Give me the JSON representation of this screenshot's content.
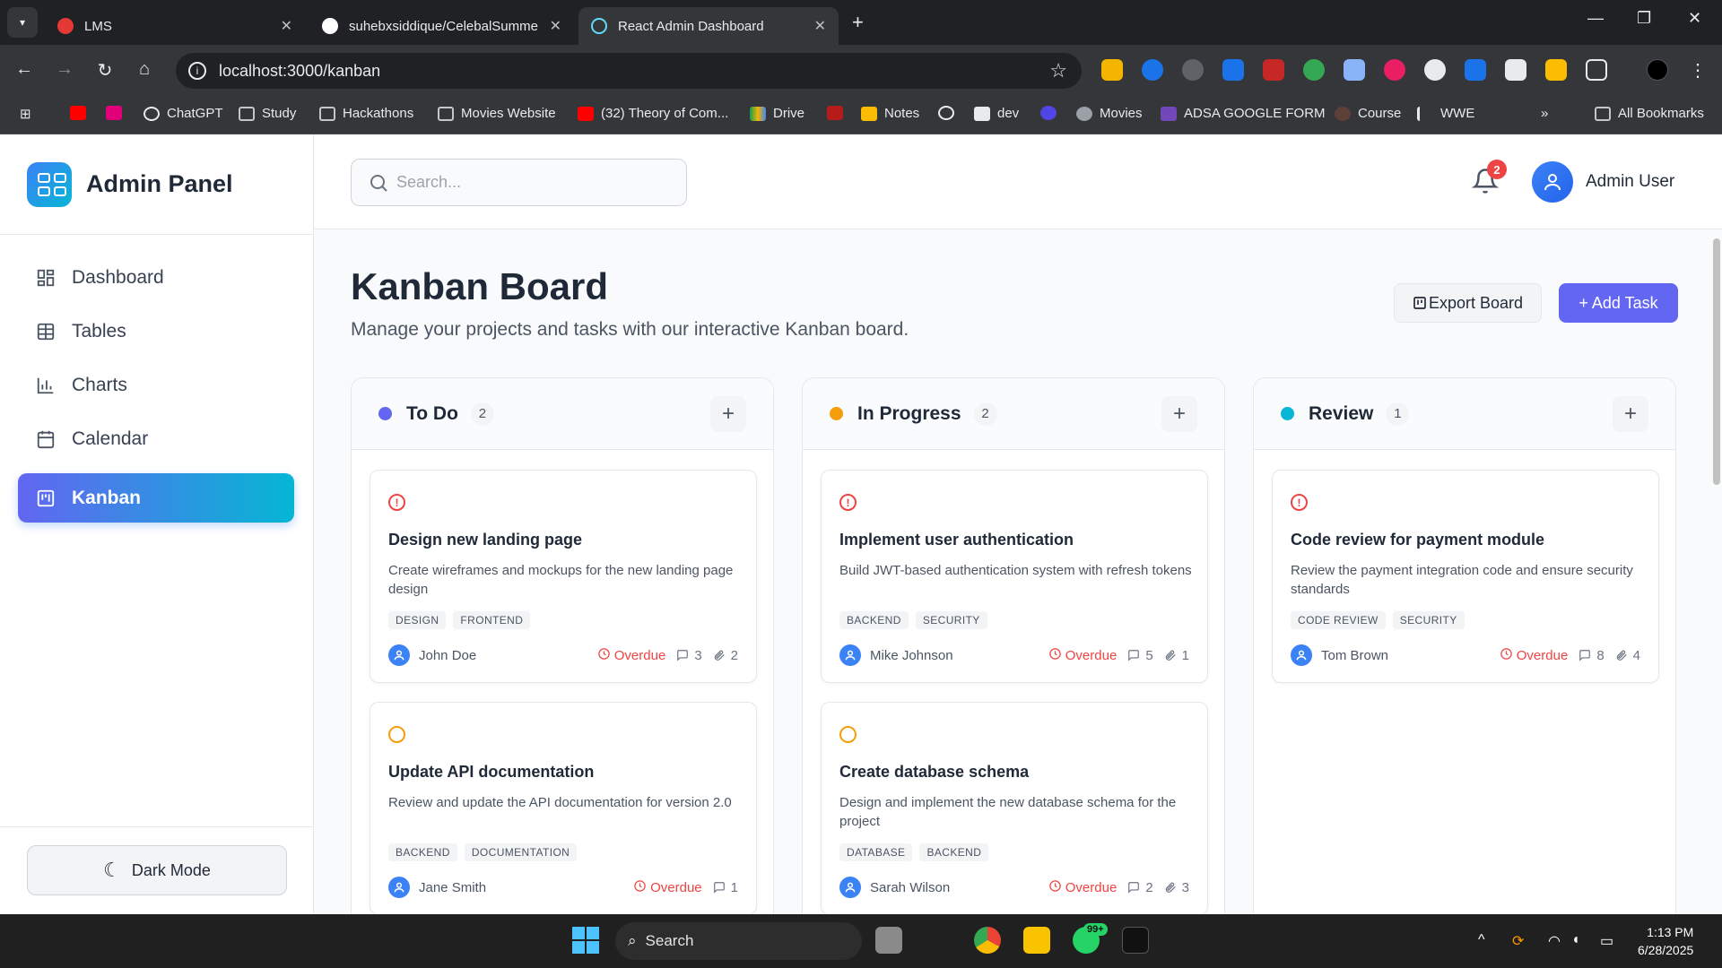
{
  "browser": {
    "tabs": [
      {
        "title": "LMS",
        "color": "#e53935",
        "active": false
      },
      {
        "title": "suhebxsiddique/CelebalSumme",
        "color": "#ffffff",
        "active": false
      },
      {
        "title": "React Admin Dashboard",
        "color": "#61dafb",
        "active": true
      }
    ],
    "url": "localhost:3000/kanban",
    "bookmarks": [
      {
        "label": "",
        "icon": "youtube-icon"
      },
      {
        "label": "",
        "icon": "m-icon"
      },
      {
        "label": "ChatGPT",
        "icon": "chatgpt-icon"
      },
      {
        "label": "Study",
        "icon": "folder-icon"
      },
      {
        "label": "Hackathons",
        "icon": "folder-icon"
      },
      {
        "label": "Movies Website",
        "icon": "folder-icon"
      },
      {
        "label": "(32) Theory of Com...",
        "icon": "youtube-icon"
      },
      {
        "label": "Drive",
        "icon": "drive-icon"
      },
      {
        "label": "",
        "icon": "cards-icon"
      },
      {
        "label": "Notes",
        "icon": "notes-icon"
      },
      {
        "label": "",
        "icon": "github-icon"
      },
      {
        "label": "dev",
        "icon": "search-icon"
      },
      {
        "label": "",
        "icon": "hex-icon"
      },
      {
        "label": "Movies",
        "icon": "globe-icon"
      },
      {
        "label": "ADSA GOOGLE FORM",
        "icon": "form-icon"
      },
      {
        "label": "Course",
        "icon": "course-icon"
      },
      {
        "label": "WWE",
        "icon": "k-icon"
      }
    ],
    "all_bookmarks": "All Bookmarks"
  },
  "sidebar": {
    "brand": "Admin Panel",
    "items": [
      {
        "label": "Dashboard",
        "icon": "dashboard-icon",
        "active": false
      },
      {
        "label": "Tables",
        "icon": "table-icon",
        "active": false
      },
      {
        "label": "Charts",
        "icon": "chart-icon",
        "active": false
      },
      {
        "label": "Calendar",
        "icon": "calendar-icon",
        "active": false
      },
      {
        "label": "Kanban",
        "icon": "kanban-icon",
        "active": true
      }
    ],
    "dark_mode": "Dark Mode"
  },
  "topbar": {
    "search_placeholder": "Search...",
    "notification_count": "2",
    "user_name": "Admin User"
  },
  "page": {
    "title": "Kanban Board",
    "subtitle": "Manage your projects and tasks with our interactive Kanban board.",
    "export_label": "Export Board",
    "add_label": "+ Add Task"
  },
  "columns": [
    {
      "title": "To Do",
      "count": "2",
      "color": "#6366f1",
      "cards": [
        {
          "priority": "high",
          "title": "Design new landing page",
          "desc": "Create wireframes and mockups for the new landing page design",
          "tags": [
            "DESIGN",
            "FRONTEND"
          ],
          "assignee": "John Doe",
          "due": "Overdue",
          "comments": "3",
          "attachments": "2"
        },
        {
          "priority": "medium",
          "title": "Update API documentation",
          "desc": "Review and update the API documentation for version 2.0",
          "tags": [
            "BACKEND",
            "DOCUMENTATION"
          ],
          "assignee": "Jane Smith",
          "due": "Overdue",
          "comments": "1",
          "attachments": ""
        }
      ]
    },
    {
      "title": "In Progress",
      "count": "2",
      "color": "#f59e0b",
      "cards": [
        {
          "priority": "high",
          "title": "Implement user authentication",
          "desc": "Build JWT-based authentication system with refresh tokens",
          "tags": [
            "BACKEND",
            "SECURITY"
          ],
          "assignee": "Mike Johnson",
          "due": "Overdue",
          "comments": "5",
          "attachments": "1"
        },
        {
          "priority": "medium",
          "title": "Create database schema",
          "desc": "Design and implement the new database schema for the project",
          "tags": [
            "DATABASE",
            "BACKEND"
          ],
          "assignee": "Sarah Wilson",
          "due": "Overdue",
          "comments": "2",
          "attachments": "3"
        }
      ]
    },
    {
      "title": "Review",
      "count": "1",
      "color": "#06b6d4",
      "cards": [
        {
          "priority": "high",
          "title": "Code review for payment module",
          "desc": "Review the payment integration code and ensure security standards",
          "tags": [
            "CODE REVIEW",
            "SECURITY"
          ],
          "assignee": "Tom Brown",
          "due": "Overdue",
          "comments": "8",
          "attachments": "4"
        }
      ]
    }
  ],
  "taskbar": {
    "search": "Search",
    "whatsapp_badge": "99+",
    "time": "1:13 PM",
    "date": "6/28/2025"
  }
}
